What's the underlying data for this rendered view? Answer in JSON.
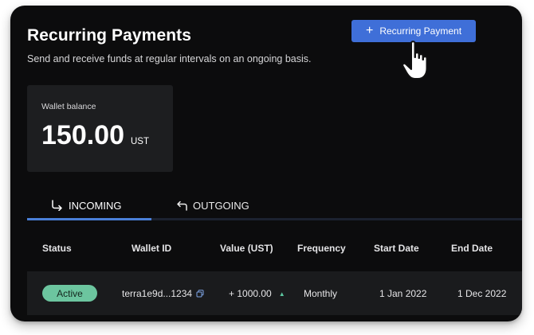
{
  "page": {
    "title": "Recurring Payments",
    "subtitle": "Send and receive funds at regular intervals on an ongoing basis."
  },
  "actions": {
    "add_button_label": "Recurring Payment",
    "add_button_icon": "plus-icon",
    "accent_color": "#3f6fd8"
  },
  "wallet": {
    "label": "Wallet balance",
    "amount": "150.00",
    "unit": "UST"
  },
  "tabs": [
    {
      "label": "INCOMING",
      "icon": "arrow-turn-down-right-icon",
      "active": true
    },
    {
      "label": "OUTGOING",
      "icon": "arrow-turn-up-left-icon",
      "active": false
    }
  ],
  "table": {
    "columns": [
      "Status",
      "Wallet ID",
      "Value (UST)",
      "Frequency",
      "Start Date",
      "End Date"
    ],
    "rows": [
      {
        "status": "Active",
        "wallet_id": "terra1e9d...1234",
        "value": "+ 1000.00",
        "frequency": "Monthly",
        "start_date": "1 Jan 2022",
        "end_date": "1 Dec 2022"
      }
    ],
    "status_color": "#6cc59f"
  }
}
